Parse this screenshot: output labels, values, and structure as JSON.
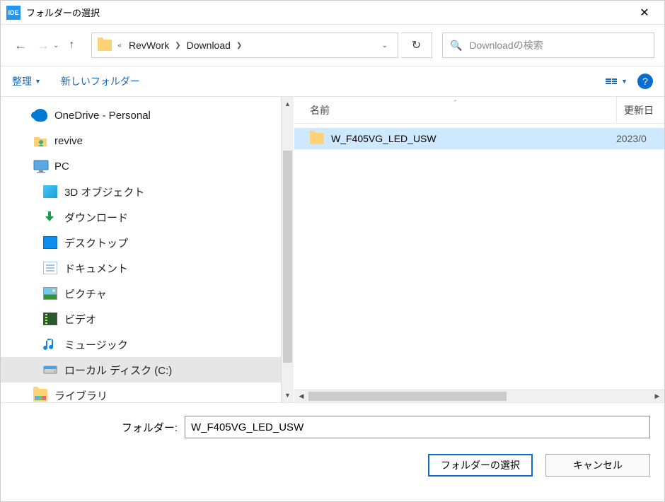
{
  "title": "フォルダーの選択",
  "title_icon": "IDE",
  "nav": {
    "back": "←",
    "forward": "→",
    "up": "↑"
  },
  "address": {
    "seg1": "RevWork",
    "seg2": "Download"
  },
  "refresh": "↻",
  "search": {
    "placeholder": "Downloadの検索"
  },
  "toolbar": {
    "organize": "整理",
    "new_folder": "新しいフォルダー",
    "help": "?"
  },
  "columns": {
    "name": "名前",
    "date": "更新日"
  },
  "tree": {
    "onedrive": "OneDrive - Personal",
    "revive": "revive",
    "pc": "PC",
    "obj3d": "3D オブジェクト",
    "downloads": "ダウンロード",
    "desktop": "デスクトップ",
    "documents": "ドキュメント",
    "pictures": "ピクチャ",
    "videos": "ビデオ",
    "music": "ミュージック",
    "localdisk": "ローカル ディスク (C:)",
    "libraries": "ライブラリ"
  },
  "row": {
    "name": "W_F405VG_LED_USW",
    "date": "2023/0"
  },
  "folder_label": "フォルダー:",
  "folder_value": "W_F405VG_LED_USW",
  "btn_select": "フォルダーの選択",
  "btn_cancel": "キャンセル"
}
